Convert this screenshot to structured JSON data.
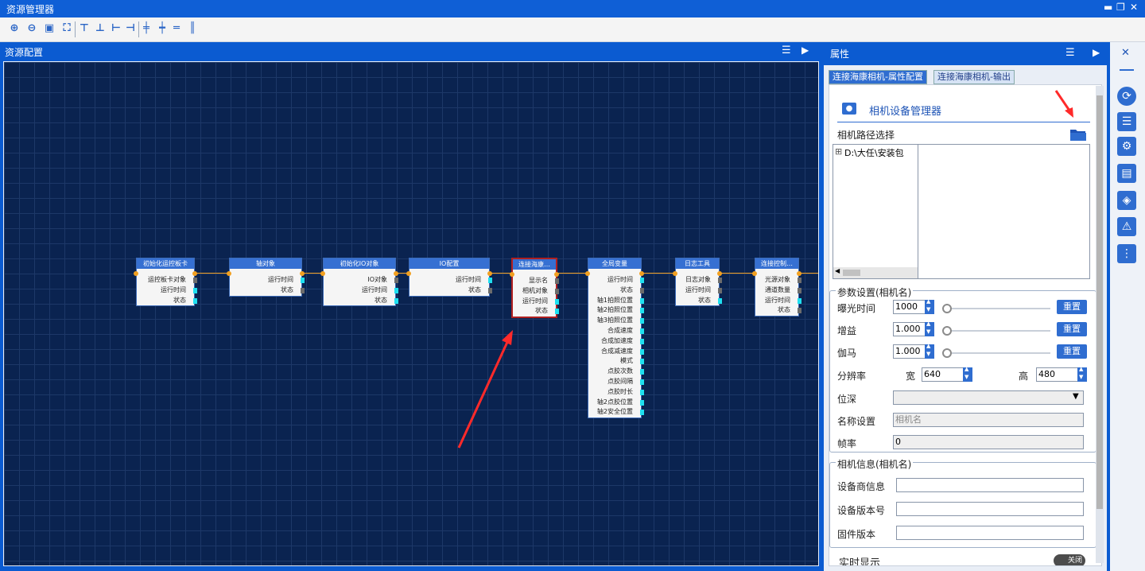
{
  "window": {
    "title": "资源管理器",
    "controls": [
      "▬",
      "❐",
      "✕"
    ]
  },
  "toolbar": {
    "icons": [
      "zoom-in-icon",
      "zoom-out-icon",
      "fit-icon",
      "fullscreen-icon",
      "align-top-icon",
      "align-bottom-icon",
      "align-left-icon",
      "align-right-icon",
      "distribute-h-icon",
      "distribute-v-icon",
      "center-h-icon",
      "center-v-icon"
    ]
  },
  "left_panel": {
    "title": "资源配置",
    "menu_icon": "☰",
    "pin_icon": "▶"
  },
  "graph": {
    "nodes": [
      {
        "title": "初始化运控板卡",
        "rows": [
          "运控板卡对象",
          "运行时间",
          "状态"
        ]
      },
      {
        "title": "轴对象",
        "rows": [
          "运行时间",
          "状态"
        ]
      },
      {
        "title": "初始化IO对象",
        "rows": [
          "IO对象",
          "运行时间",
          "状态"
        ]
      },
      {
        "title": "IO配置",
        "rows": [
          "运行时间",
          "状态"
        ]
      },
      {
        "title": "连接海康…",
        "rows": [
          "显示名",
          "相机对象",
          "运行时间",
          "状态"
        ]
      },
      {
        "title": "全局变量",
        "rows": [
          "运行时间",
          "状态",
          "轴1拍照位置",
          "轴2拍照位置",
          "轴3拍照位置",
          "合成速度",
          "合成加速度",
          "合成减速度",
          "模式",
          "点胶次数",
          "点胶间隔",
          "点胶时长",
          "轴2点胶位置",
          "轴2安全位置"
        ]
      },
      {
        "title": "日志工具",
        "rows": [
          "日志对象",
          "运行时间",
          "状态"
        ]
      },
      {
        "title": "连接控制…",
        "rows": [
          "光源对象",
          "通道数量",
          "运行时间",
          "状态"
        ]
      }
    ]
  },
  "properties": {
    "title": "属性",
    "tabs": [
      "连接海康相机-属性配置",
      "连接海康相机-输出"
    ],
    "header": "相机设备管理器",
    "path_label": "相机路径选择",
    "tree_item": "D:\\大任\\安装包",
    "params_group": "参数设置(相机名)",
    "exposure_label": "曝光时间",
    "exposure_value": "1000",
    "gain_label": "增益",
    "gain_value": "1.000",
    "gamma_label": "伽马",
    "gamma_value": "1.000",
    "reset_label": "重置",
    "resolution_label": "分辨率",
    "width_label": "宽",
    "width_value": "640",
    "height_label": "高",
    "height_value": "480",
    "bitdepth_label": "位深",
    "name_label": "名称设置",
    "name_placeholder": "相机名",
    "fps_label": "帧率",
    "fps_value": "0",
    "info_group": "相机信息(相机名)",
    "vendor_label": "设备商信息",
    "version_label": "设备版本号",
    "firmware_label": "固件版本",
    "live_label": "实时显示",
    "toggle_label": "关闭"
  },
  "colors": {
    "accent": "#0b5bd1",
    "canvas": "#0a2350",
    "node_header": "#3670d2",
    "connector": "#f2a020",
    "port_cyan": "#1ee0f0",
    "port_gray": "#6c6c6c"
  }
}
